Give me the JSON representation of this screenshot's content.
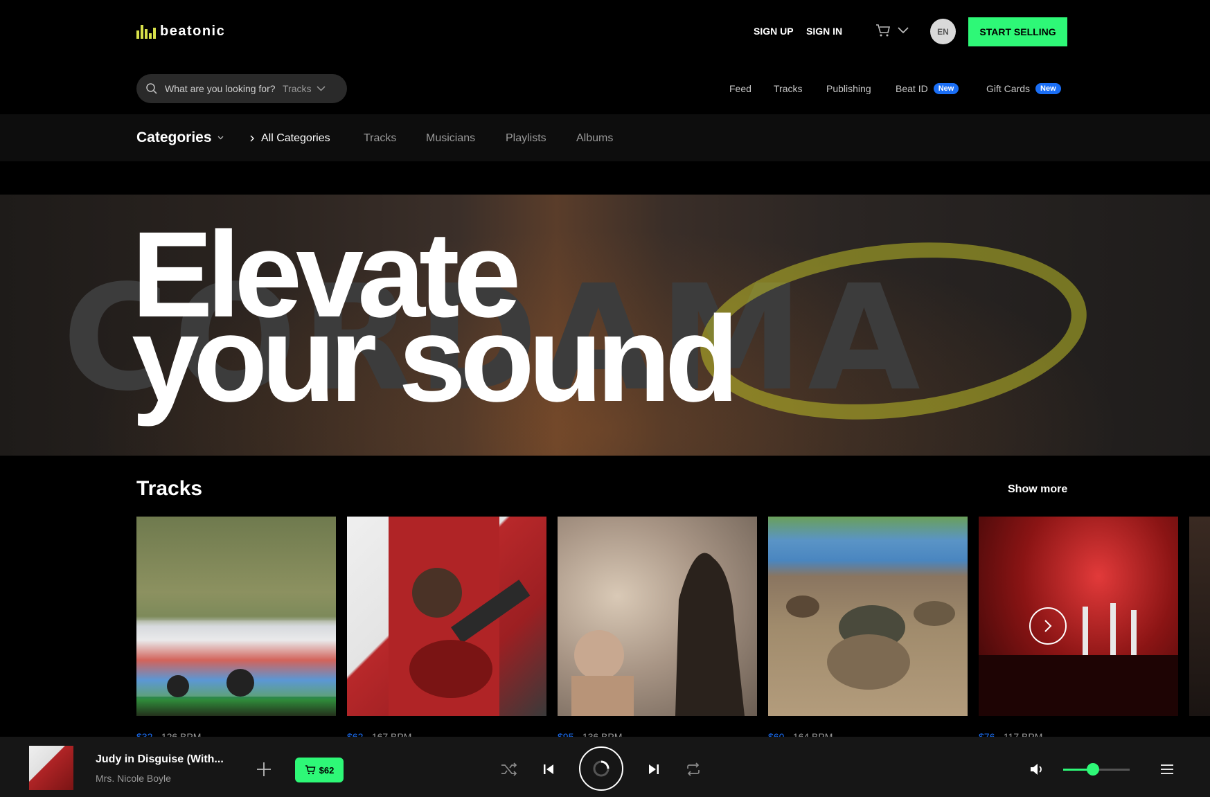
{
  "brand": {
    "name": "beatonic",
    "accent": "#2ef877",
    "badge_color": "#1a6ef5"
  },
  "header": {
    "sign_up": "SIGN UP",
    "sign_in": "SIGN IN",
    "language": "EN",
    "start_selling": "START SELLING"
  },
  "search": {
    "placeholder": "What are you looking for?",
    "type": "Tracks"
  },
  "topnav": [
    {
      "label": "Feed"
    },
    {
      "label": "Tracks"
    },
    {
      "label": "Publishing"
    },
    {
      "label": "Beat ID",
      "badge": "New"
    },
    {
      "label": "Gift Cards",
      "badge": "New"
    }
  ],
  "categories": {
    "title": "Categories",
    "items": [
      "All Categories",
      "Tracks",
      "Musicians",
      "Playlists",
      "Albums"
    ],
    "active": "All Categories"
  },
  "hero": {
    "line1": "Elevate",
    "line2": "your sound",
    "background_text": "CORDAMA"
  },
  "tracks": {
    "title": "Tracks",
    "show_more": "Show more",
    "items": [
      {
        "price": "$32",
        "bpm": "126 BPM",
        "image": "painted-bus-festival-photo"
      },
      {
        "price": "$62",
        "bpm": "167 BPM",
        "image": "guitarist-red-shirt-photo"
      },
      {
        "price": "$95",
        "bpm": "136 BPM",
        "image": "concert-silhouette-photo"
      },
      {
        "price": "$60",
        "bpm": "164 BPM",
        "image": "mud-race-photo"
      },
      {
        "price": "$76",
        "bpm": "117 BPM",
        "image": "red-stage-concert-photo"
      }
    ]
  },
  "player": {
    "title": "Judy in Disguise (With...",
    "artist": "Mrs. Nicole Boyle",
    "price": "$62",
    "volume": 0.45
  }
}
